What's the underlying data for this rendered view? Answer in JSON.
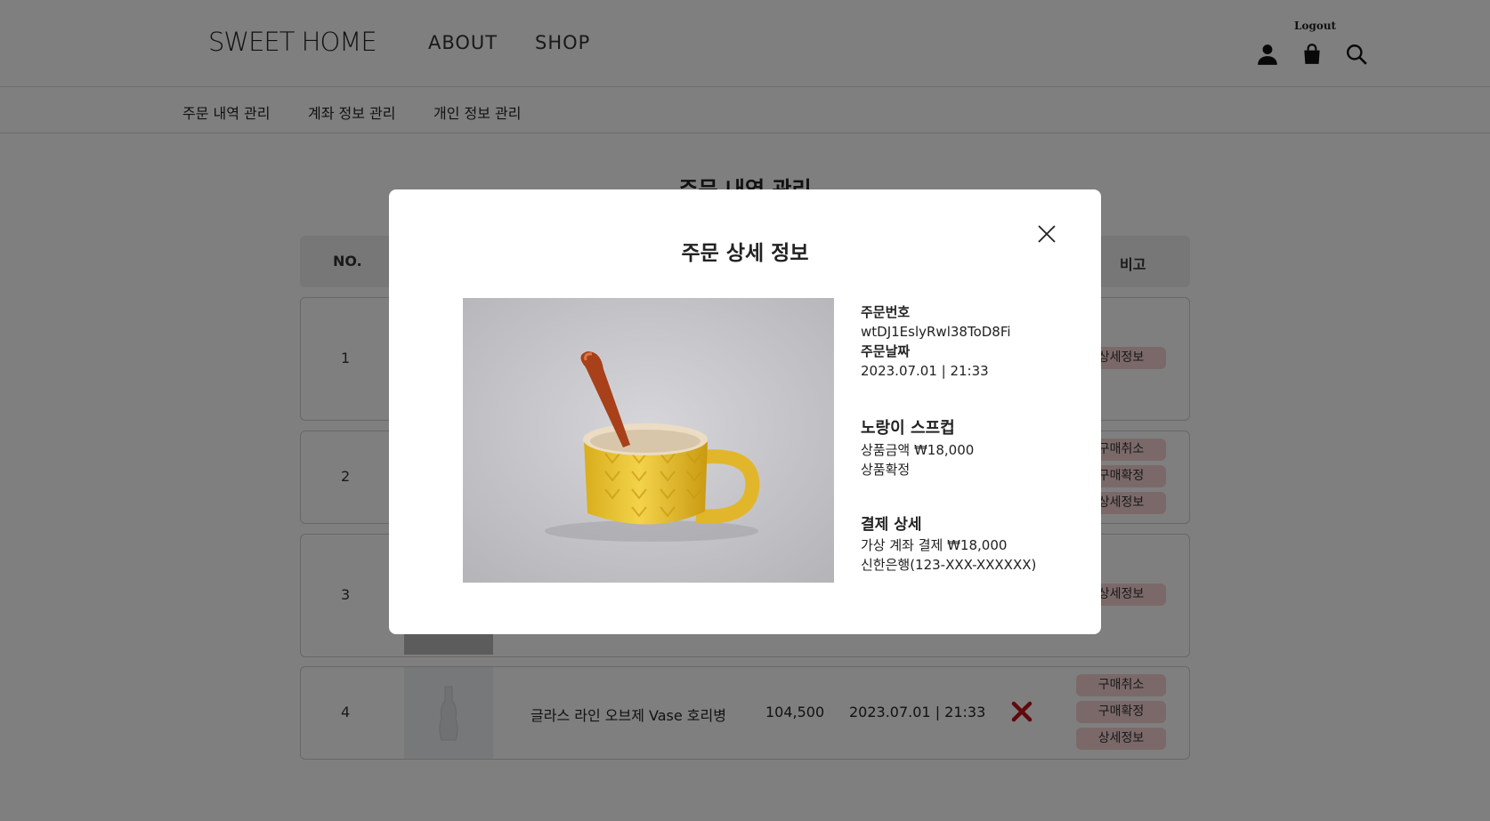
{
  "header": {
    "logo": "SWEET HOME",
    "nav": [
      "ABOUT",
      "SHOP"
    ],
    "logout": "Logout",
    "icons": [
      "user-icon",
      "shopping-bag-icon",
      "search-icon"
    ]
  },
  "subnav": {
    "items": [
      "주문 내역 관리",
      "계좌 정보 관리",
      "개인 정보 관리"
    ]
  },
  "main": {
    "title": "주문 내역 관리",
    "table_headers": {
      "no": "NO.",
      "note": "비고"
    },
    "rows": [
      {
        "no": "1",
        "buttons": [
          "상세정보"
        ]
      },
      {
        "no": "2",
        "buttons": [
          "구매취소",
          "구매확정",
          "상세정보"
        ]
      },
      {
        "no": "3",
        "buttons": [
          "상세정보"
        ]
      },
      {
        "no": "4",
        "name": "글라스 라인 오브제 Vase 호리병",
        "price": "104,500",
        "date": "2023.07.01 | 21:33",
        "status_icon": "x-icon",
        "buttons": [
          "구매취소",
          "구매확정",
          "상세정보"
        ]
      }
    ]
  },
  "modal": {
    "title": "주문 상세 정보",
    "order_number_label": "주문번호",
    "order_number": "wtDJ1EslyRwl38ToD8Fi",
    "order_date_label": "주문날짜",
    "order_date": "2023.07.01 | 21:33",
    "product_name": "노랑이 스프컵",
    "product_price": "상품금액 ₩18,000",
    "product_status": "상품확정",
    "payment_label": "결제 상세",
    "payment_method": "가상 계좌 결제 ₩18,000",
    "payment_bank": "신한은행(123-XXX-XXXXXX)"
  },
  "colors": {
    "button_bg": "#f7d3d3",
    "overlay": "rgba(0,0,0,0.5)",
    "cancel_x": "#c0121b"
  }
}
